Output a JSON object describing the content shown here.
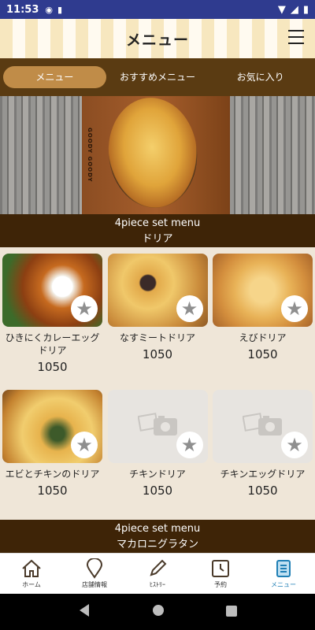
{
  "status_bar": {
    "time": "11:53"
  },
  "header": {
    "title": "メニュー"
  },
  "tabs": [
    {
      "label": "メニュー",
      "active": true
    },
    {
      "label": "おすすめメニュー",
      "active": false
    },
    {
      "label": "お気に入り",
      "active": false
    }
  ],
  "hero": {
    "brand": "GOODY GOODY"
  },
  "section1": {
    "sub": "4piece set menu",
    "name": "ドリア"
  },
  "items_row1": [
    {
      "title": "ひきにくカレーエッグドリア",
      "price": "1050",
      "has_photo": true
    },
    {
      "title": "なすミートドリア",
      "price": "1050",
      "has_photo": true
    },
    {
      "title": "えびドリア",
      "price": "1050",
      "has_photo": true
    }
  ],
  "items_row2": [
    {
      "title": "エビとチキンのドリア",
      "price": "1050",
      "has_photo": true
    },
    {
      "title": "チキンドリア",
      "price": "1050",
      "has_photo": false
    },
    {
      "title": "チキンエッグドリア",
      "price": "1050",
      "has_photo": false
    }
  ],
  "section2": {
    "sub": "4piece set menu",
    "name": "マカロニグラタン"
  },
  "bottom_nav": [
    {
      "label": "ホーム",
      "icon": "home-icon"
    },
    {
      "label": "店舗情報",
      "icon": "map-pin-icon"
    },
    {
      "label": "ﾋｽﾄﾘｰ",
      "icon": "pencil-icon"
    },
    {
      "label": "予約",
      "icon": "clock-icon"
    },
    {
      "label": "メニュー",
      "icon": "menu-book-icon",
      "active": true
    }
  ],
  "colors": {
    "accent": "#c08c48",
    "band": "#3e2407",
    "nav_active": "#1f7fb5",
    "status_bar": "#2f3b8f"
  }
}
